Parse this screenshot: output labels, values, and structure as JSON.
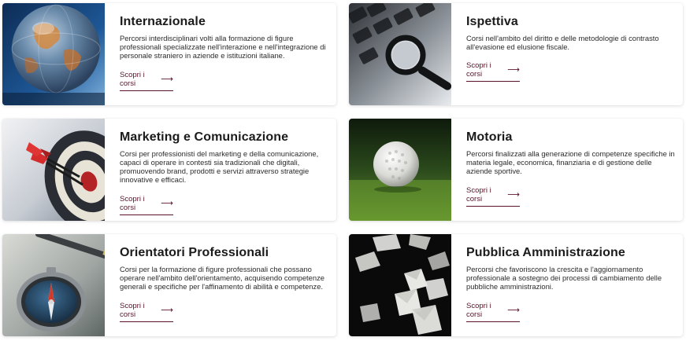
{
  "cards": [
    {
      "title": "Internazionale",
      "description": "Percorsi interdisciplinari volti alla formazione di figure professionali specializzate nell'interazione e nell'integrazione di personale straniero in aziende e istituzioni italiane.",
      "cta": "Scopri i corsi",
      "image": "globe-image"
    },
    {
      "title": "Ispettiva",
      "description": "Corsi nell'ambito del diritto e delle metodologie di contrasto all'evasione ed elusione fiscale.",
      "cta": "Scopri i corsi",
      "image": "magnifier-keyboard-image"
    },
    {
      "title": "Marketing e Comunicazione",
      "description": "Corsi per professionisti del marketing e della comunicazione, capaci di operare in contesti sia tradizionali che digitali, promuovendo brand, prodotti e servizi attraverso strategie innovative e efficaci.",
      "cta": "Scopri i corsi",
      "image": "dartboard-image"
    },
    {
      "title": "Motoria",
      "description": "Percorsi finalizzati alla generazione di competenze specifiche in materia legale, economica, finanziaria e di gestione delle aziende sportive.",
      "cta": "Scopri i corsi",
      "image": "golf-ball-image"
    },
    {
      "title": "Orientatori Professionali",
      "description": "Corsi per la formazione di figure professionali che possano operare nell'ambito dell'orientamento, acquisendo competenze generali e specifiche per l'affinamento di abilità e competenze.",
      "cta": "Scopri i corsi",
      "image": "compass-image"
    },
    {
      "title": "Pubblica Amministrazione",
      "description": "Percorsi che favoriscono la crescita e l'aggiornamento professionale a sostegno dei processi di cambiamento delle pubbliche amministrazioni.",
      "cta": "Scopri i corsi",
      "image": "flying-papers-image"
    }
  ],
  "colors": {
    "accent": "#5a1228",
    "title": "#1b1b1b",
    "text": "#2b2b2b"
  },
  "icons": {
    "cta_arrow": "arrow-right-icon",
    "cta_arrow_glyph": "⟶"
  }
}
